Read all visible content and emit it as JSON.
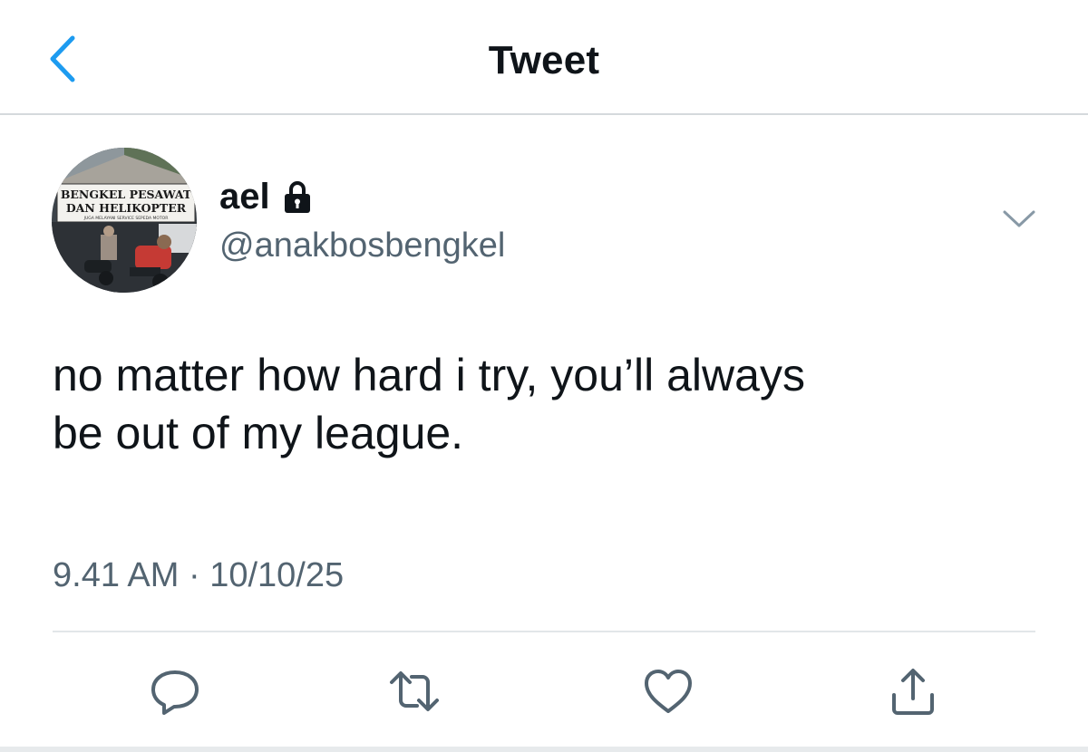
{
  "nav": {
    "title": "Tweet",
    "back_icon": "chevron-left-icon"
  },
  "author": {
    "name": "ael",
    "handle": "@anakbosbengkel",
    "protected_icon": "lock-icon",
    "avatar_sign_line1": "BENGKEL PESAWAT",
    "avatar_sign_line2": "DAN HELIKOPTER",
    "avatar_sign_line3": "JUGA MELAYANI SERVICE SEPEDA MOTOR"
  },
  "tweet": {
    "text_line1": "no matter how hard i try, you’ll always",
    "text_line2": "be out of my league.",
    "timestamp": "9.41 AM · 10/10/25"
  },
  "actions": [
    {
      "icon": "reply-icon"
    },
    {
      "icon": "retweet-icon"
    },
    {
      "icon": "like-icon"
    },
    {
      "icon": "share-icon"
    }
  ],
  "colors": {
    "accent": "#1d9bf0",
    "text": "#0f1419",
    "secondary_text": "#536471",
    "icon_gray": "#536471",
    "divider": "#d5d9dc"
  }
}
